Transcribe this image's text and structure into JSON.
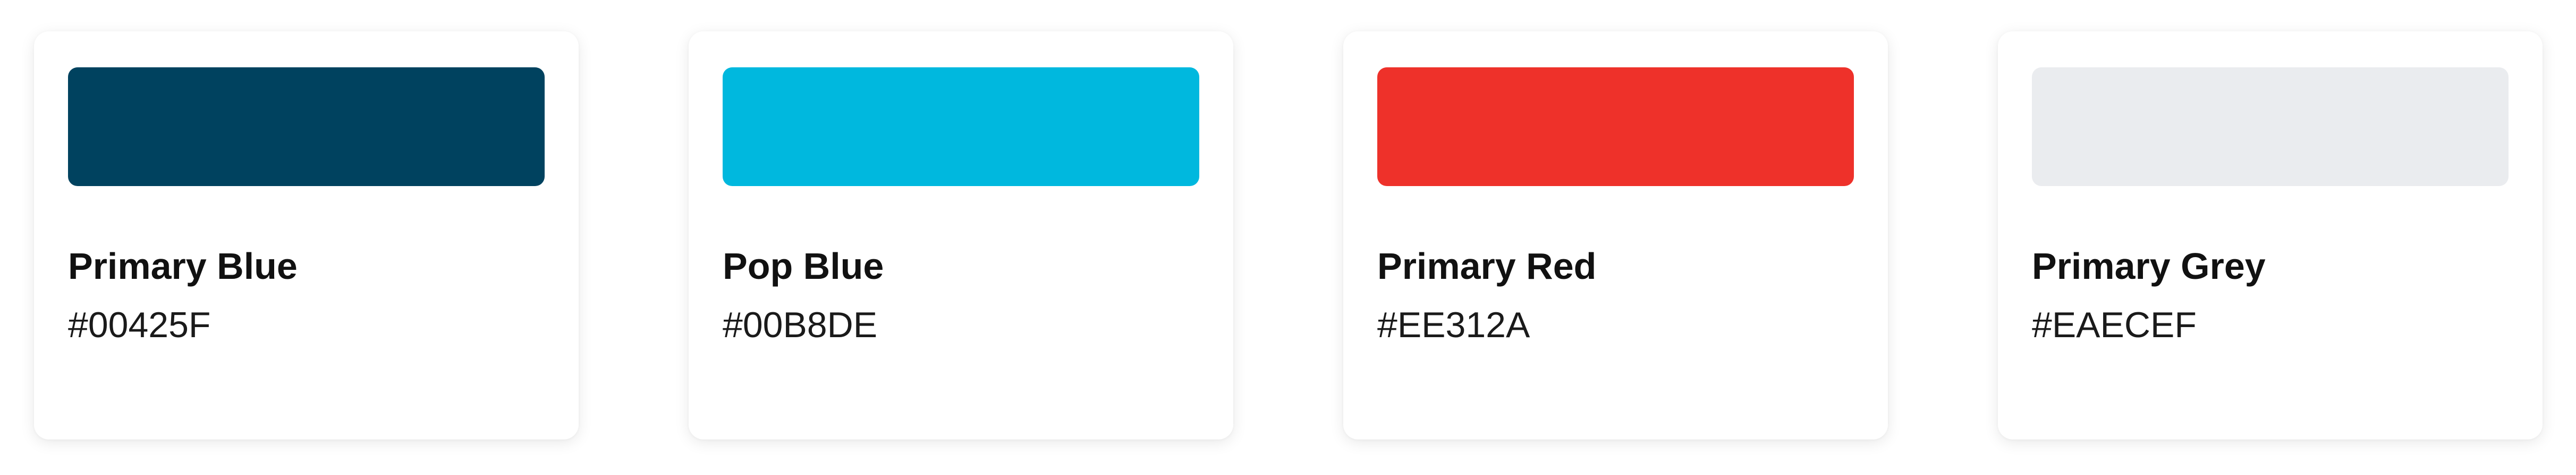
{
  "palette": {
    "colors": [
      {
        "name": "Primary Blue",
        "hex": "#00425F",
        "swatch": "#00425F"
      },
      {
        "name": "Pop Blue",
        "hex": "#00B8DE",
        "swatch": "#00B8DE"
      },
      {
        "name": "Primary Red",
        "hex": "#EE312A",
        "swatch": "#EE312A"
      },
      {
        "name": "Primary Grey",
        "hex": "#EAECEF",
        "swatch": "#EAECEF"
      }
    ]
  }
}
